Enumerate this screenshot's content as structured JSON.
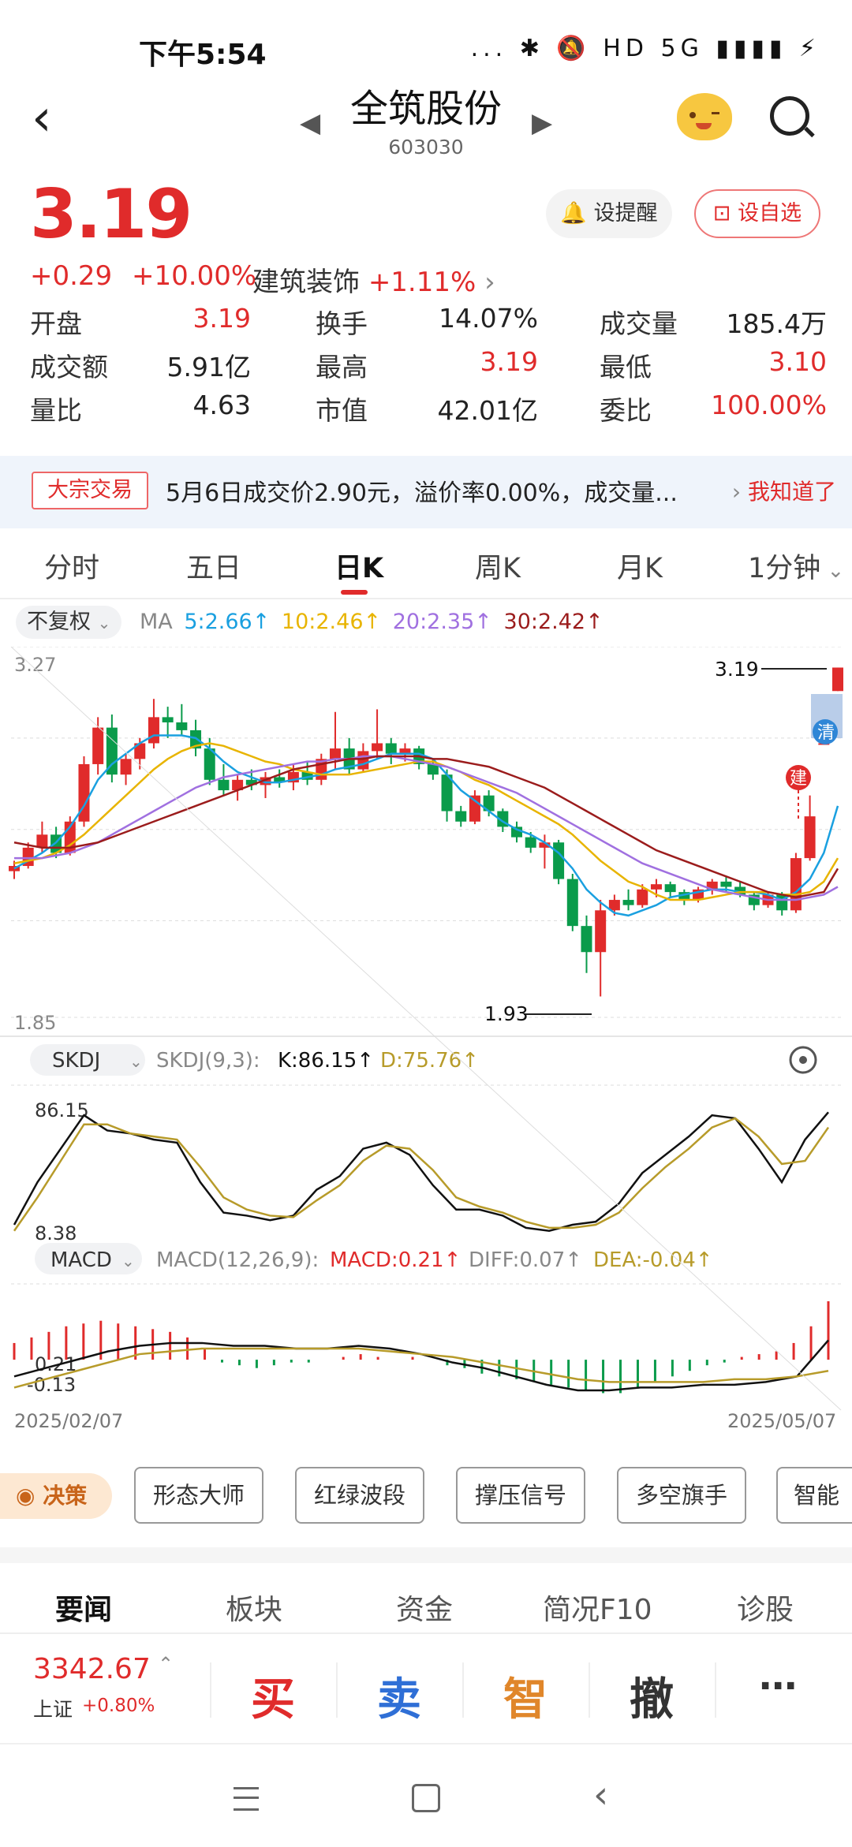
{
  "status": {
    "time": "下午5:54",
    "icons": "... ✱ 🔕 HD 5G ▮▮▮▮ ⚡"
  },
  "header": {
    "name": "全筑股份",
    "code": "603030"
  },
  "price": {
    "last": "3.19",
    "change": "+0.29",
    "change_pct": "+10.00%",
    "sector": "建筑装饰",
    "sector_pct": "+1.11%"
  },
  "buttons": {
    "alert": "设提醒",
    "favorite": "设自选"
  },
  "quote": [
    [
      {
        "label": "开盘",
        "value": "3.19",
        "color": "red"
      },
      {
        "label": "换手",
        "value": "14.07%",
        "color": "black"
      },
      {
        "label": "成交量",
        "value": "185.4万",
        "color": "black"
      }
    ],
    [
      {
        "label": "成交额",
        "value": "5.91亿",
        "color": "black"
      },
      {
        "label": "最高",
        "value": "3.19",
        "color": "red"
      },
      {
        "label": "最低",
        "value": "3.10",
        "color": "red"
      }
    ],
    [
      {
        "label": "量比",
        "value": "4.63",
        "color": "black"
      },
      {
        "label": "市值",
        "value": "42.01亿",
        "color": "black"
      },
      {
        "label": "委比",
        "value": "100.00%",
        "color": "red"
      }
    ]
  ],
  "notice": {
    "tag": "大宗交易",
    "text": "5月6日成交价2.90元，溢价率0.00%，成交量...",
    "action": "我知道了"
  },
  "tabs": [
    "分时",
    "五日",
    "日K",
    "周K",
    "月K",
    "1分钟"
  ],
  "ma": {
    "adjust": "不复权",
    "label": "MA",
    "ma5": "5:2.66↑",
    "ma10": "10:2.46↑",
    "ma20": "20:2.35↑",
    "ma30": "30:2.42↑"
  },
  "kline": {
    "y_top": "3.27",
    "y_bottom": "1.85",
    "high_label": "3.19",
    "low_label": "1.93",
    "mark_clear": "清",
    "mark_build": "建",
    "start_date": "2025/02/07",
    "end_date": "2025/05/07"
  },
  "skdj": {
    "selector": "SKDJ",
    "params": "SKDJ(9,3):",
    "k": "K:86.15↑",
    "d": "D:75.76↑",
    "y_top": "86.15",
    "y_bottom": "8.38"
  },
  "macd": {
    "selector": "MACD",
    "params": "MACD(12,26,9):",
    "macd": "MACD:0.21↑",
    "diff": "DIFF:0.07↑",
    "dea": "DEA:-0.04↑",
    "y_top": "0.21",
    "y_bottom": "-0.13"
  },
  "strategies": {
    "decision": "决策",
    "items": [
      "形态大师",
      "红绿波段",
      "撑压信号",
      "多空旗手",
      "智能化"
    ]
  },
  "news_tabs": [
    "要闻",
    "板块",
    "资金",
    "简况F10",
    "诊股"
  ],
  "index": {
    "value": "3342.67",
    "name": "上证",
    "change": "+0.80%"
  },
  "trade": {
    "buy": "买",
    "sell": "卖",
    "smart": "智",
    "cancel": "撤",
    "more": "⋯"
  },
  "colors": {
    "up": "#e02b2b",
    "down": "#0a9b4b",
    "ma5": "#1aa0e0",
    "ma10": "#e8b400",
    "ma20": "#a070e0",
    "ma30": "#9b1c1c"
  },
  "chart_data": {
    "type": "candlestick",
    "x_range": [
      "2025/02/07",
      "2025/05/07"
    ],
    "ylim": [
      1.85,
      3.27
    ],
    "high": 3.19,
    "low": 1.93,
    "ohlc": [
      [
        2.41,
        2.45,
        2.38,
        2.43
      ],
      [
        2.43,
        2.52,
        2.42,
        2.5
      ],
      [
        2.5,
        2.6,
        2.48,
        2.55
      ],
      [
        2.55,
        2.58,
        2.46,
        2.48
      ],
      [
        2.48,
        2.62,
        2.47,
        2.6
      ],
      [
        2.6,
        2.85,
        2.58,
        2.82
      ],
      [
        2.82,
        3.0,
        2.78,
        2.96
      ],
      [
        2.96,
        3.01,
        2.75,
        2.78
      ],
      [
        2.78,
        2.86,
        2.74,
        2.84
      ],
      [
        2.84,
        2.92,
        2.8,
        2.9
      ],
      [
        2.9,
        3.07,
        2.88,
        3.0
      ],
      [
        3.0,
        3.04,
        2.92,
        2.98
      ],
      [
        2.98,
        3.05,
        2.93,
        2.95
      ],
      [
        2.95,
        2.99,
        2.85,
        2.88
      ],
      [
        2.88,
        2.92,
        2.74,
        2.76
      ],
      [
        2.76,
        2.82,
        2.7,
        2.72
      ],
      [
        2.72,
        2.78,
        2.68,
        2.76
      ],
      [
        2.76,
        2.8,
        2.72,
        2.74
      ],
      [
        2.74,
        2.79,
        2.69,
        2.77
      ],
      [
        2.77,
        2.8,
        2.73,
        2.75
      ],
      [
        2.75,
        2.82,
        2.72,
        2.79
      ],
      [
        2.79,
        2.83,
        2.74,
        2.76
      ],
      [
        2.76,
        2.86,
        2.74,
        2.84
      ],
      [
        2.84,
        3.02,
        2.8,
        2.88
      ],
      [
        2.88,
        2.92,
        2.78,
        2.8
      ],
      [
        2.8,
        2.9,
        2.79,
        2.87
      ],
      [
        2.87,
        3.03,
        2.84,
        2.9
      ],
      [
        2.9,
        2.92,
        2.82,
        2.86
      ],
      [
        2.86,
        2.9,
        2.83,
        2.88
      ],
      [
        2.88,
        2.89,
        2.8,
        2.82
      ],
      [
        2.82,
        2.84,
        2.76,
        2.78
      ],
      [
        2.78,
        2.8,
        2.6,
        2.64
      ],
      [
        2.64,
        2.66,
        2.58,
        2.6
      ],
      [
        2.6,
        2.72,
        2.59,
        2.7
      ],
      [
        2.7,
        2.72,
        2.62,
        2.64
      ],
      [
        2.64,
        2.65,
        2.56,
        2.58
      ],
      [
        2.58,
        2.6,
        2.52,
        2.54
      ],
      [
        2.54,
        2.56,
        2.48,
        2.5
      ],
      [
        2.5,
        2.55,
        2.42,
        2.52
      ],
      [
        2.52,
        2.53,
        2.36,
        2.38
      ],
      [
        2.38,
        2.4,
        2.18,
        2.2
      ],
      [
        2.2,
        2.24,
        2.02,
        2.1
      ],
      [
        2.1,
        2.3,
        1.93,
        2.26
      ],
      [
        2.26,
        2.32,
        2.24,
        2.3
      ],
      [
        2.3,
        2.34,
        2.26,
        2.28
      ],
      [
        2.28,
        2.36,
        2.27,
        2.34
      ],
      [
        2.34,
        2.38,
        2.31,
        2.36
      ],
      [
        2.36,
        2.37,
        2.31,
        2.33
      ],
      [
        2.33,
        2.34,
        2.28,
        2.3
      ],
      [
        2.3,
        2.35,
        2.29,
        2.34
      ],
      [
        2.34,
        2.38,
        2.32,
        2.37
      ],
      [
        2.37,
        2.39,
        2.33,
        2.35
      ],
      [
        2.35,
        2.37,
        2.31,
        2.32
      ],
      [
        2.32,
        2.33,
        2.26,
        2.28
      ],
      [
        2.28,
        2.33,
        2.27,
        2.32
      ],
      [
        2.32,
        2.33,
        2.24,
        2.26
      ],
      [
        2.26,
        2.48,
        2.25,
        2.46
      ],
      [
        2.46,
        2.7,
        2.45,
        2.62
      ],
      [
        2.9,
        2.9,
        2.9,
        2.9
      ],
      [
        3.1,
        3.19,
        3.1,
        3.19
      ]
    ],
    "ma": {
      "MA5": [
        2.42,
        2.45,
        2.48,
        2.52,
        2.58,
        2.66,
        2.76,
        2.82,
        2.86,
        2.9,
        2.93,
        2.93,
        2.93,
        2.92,
        2.88,
        2.83,
        2.79,
        2.77,
        2.75,
        2.75,
        2.76,
        2.77,
        2.78,
        2.8,
        2.81,
        2.82,
        2.84,
        2.86,
        2.86,
        2.86,
        2.84,
        2.78,
        2.72,
        2.68,
        2.64,
        2.6,
        2.57,
        2.55,
        2.52,
        2.48,
        2.42,
        2.34,
        2.29,
        2.25,
        2.24,
        2.26,
        2.28,
        2.31,
        2.32,
        2.33,
        2.34,
        2.34,
        2.33,
        2.33,
        2.32,
        2.3,
        2.33,
        2.38,
        2.48,
        2.66
      ],
      "MA10": [
        2.44,
        2.45,
        2.46,
        2.48,
        2.51,
        2.55,
        2.6,
        2.65,
        2.7,
        2.75,
        2.8,
        2.84,
        2.87,
        2.89,
        2.9,
        2.89,
        2.87,
        2.85,
        2.83,
        2.82,
        2.8,
        2.79,
        2.78,
        2.78,
        2.78,
        2.79,
        2.8,
        2.81,
        2.82,
        2.83,
        2.83,
        2.81,
        2.79,
        2.76,
        2.74,
        2.71,
        2.68,
        2.65,
        2.62,
        2.59,
        2.55,
        2.5,
        2.45,
        2.41,
        2.37,
        2.35,
        2.32,
        2.3,
        2.3,
        2.3,
        2.31,
        2.32,
        2.33,
        2.33,
        2.33,
        2.32,
        2.32,
        2.33,
        2.37,
        2.46
      ],
      "MA20": [
        2.46,
        2.46,
        2.46,
        2.47,
        2.48,
        2.5,
        2.52,
        2.55,
        2.58,
        2.61,
        2.64,
        2.67,
        2.7,
        2.73,
        2.75,
        2.77,
        2.78,
        2.79,
        2.8,
        2.81,
        2.82,
        2.83,
        2.83,
        2.84,
        2.84,
        2.85,
        2.85,
        2.85,
        2.84,
        2.83,
        2.82,
        2.81,
        2.79,
        2.77,
        2.75,
        2.73,
        2.71,
        2.68,
        2.65,
        2.62,
        2.59,
        2.56,
        2.53,
        2.5,
        2.47,
        2.44,
        2.42,
        2.4,
        2.38,
        2.36,
        2.34,
        2.33,
        2.32,
        2.31,
        2.3,
        2.3,
        2.3,
        2.31,
        2.32,
        2.35
      ],
      "MA30": [
        2.52,
        2.51,
        2.5,
        2.5,
        2.5,
        2.51,
        2.52,
        2.54,
        2.56,
        2.58,
        2.6,
        2.62,
        2.64,
        2.66,
        2.68,
        2.7,
        2.72,
        2.74,
        2.76,
        2.78,
        2.8,
        2.81,
        2.82,
        2.83,
        2.84,
        2.84,
        2.85,
        2.85,
        2.85,
        2.85,
        2.84,
        2.84,
        2.83,
        2.82,
        2.81,
        2.79,
        2.77,
        2.75,
        2.73,
        2.7,
        2.67,
        2.64,
        2.61,
        2.58,
        2.55,
        2.52,
        2.49,
        2.47,
        2.45,
        2.43,
        2.41,
        2.39,
        2.37,
        2.35,
        2.33,
        2.32,
        2.31,
        2.32,
        2.33,
        2.42
      ]
    },
    "skdj": {
      "ylim": [
        8.38,
        86.15
      ],
      "K": [
        12,
        40,
        62,
        84,
        74,
        72,
        68,
        66,
        40,
        20,
        18,
        15,
        18,
        35,
        44,
        62,
        66,
        58,
        38,
        22,
        22,
        18,
        10,
        8,
        12,
        14,
        26,
        46,
        58,
        70,
        84,
        82,
        62,
        40,
        68,
        86
      ],
      "D": [
        8,
        30,
        54,
        78,
        78,
        72,
        70,
        68,
        50,
        30,
        22,
        18,
        17,
        28,
        38,
        54,
        64,
        62,
        48,
        30,
        24,
        20,
        14,
        10,
        10,
        12,
        20,
        36,
        50,
        62,
        76,
        82,
        70,
        52,
        54,
        76
      ]
    },
    "macd": {
      "ylim": [
        -0.13,
        0.21
      ],
      "hist": [
        0.06,
        0.08,
        0.1,
        0.12,
        0.13,
        0.14,
        0.13,
        0.12,
        0.11,
        0.1,
        0.08,
        0.04,
        -0.01,
        -0.02,
        -0.03,
        -0.02,
        -0.01,
        -0.01,
        0.0,
        0.01,
        0.02,
        0.01,
        0.0,
        0.01,
        0.0,
        -0.02,
        -0.03,
        -0.05,
        -0.06,
        -0.07,
        -0.08,
        -0.09,
        -0.1,
        -0.11,
        -0.12,
        -0.12,
        -0.1,
        -0.08,
        -0.06,
        -0.04,
        -0.02,
        -0.01,
        0.01,
        0.02,
        0.03,
        0.06,
        0.12,
        0.21
      ],
      "DIFF": [
        -0.06,
        -0.03,
        0.0,
        0.03,
        0.05,
        0.06,
        0.06,
        0.05,
        0.05,
        0.04,
        0.04,
        0.05,
        0.04,
        0.02,
        -0.01,
        -0.03,
        -0.06,
        -0.09,
        -0.11,
        -0.11,
        -0.1,
        -0.1,
        -0.09,
        -0.09,
        -0.08,
        -0.06,
        0.07
      ],
      "DEA": [
        -0.1,
        -0.07,
        -0.04,
        -0.01,
        0.02,
        0.03,
        0.04,
        0.04,
        0.04,
        0.04,
        0.04,
        0.04,
        0.03,
        0.02,
        0.01,
        -0.01,
        -0.03,
        -0.05,
        -0.07,
        -0.08,
        -0.08,
        -0.08,
        -0.08,
        -0.07,
        -0.07,
        -0.06,
        -0.04
      ]
    }
  }
}
